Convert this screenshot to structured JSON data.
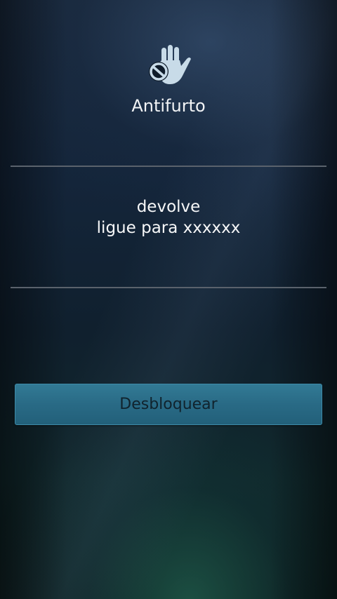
{
  "app": {
    "icon": "hand-stop-icon",
    "title": "Antifurto"
  },
  "message": {
    "line1": "devolve",
    "line2": "ligue para xxxxxx"
  },
  "unlock_button": {
    "label": "Desbloquear"
  },
  "colors": {
    "button": "#2b6d88",
    "icon": "#c8dbe8",
    "divider": "#5a626c"
  }
}
